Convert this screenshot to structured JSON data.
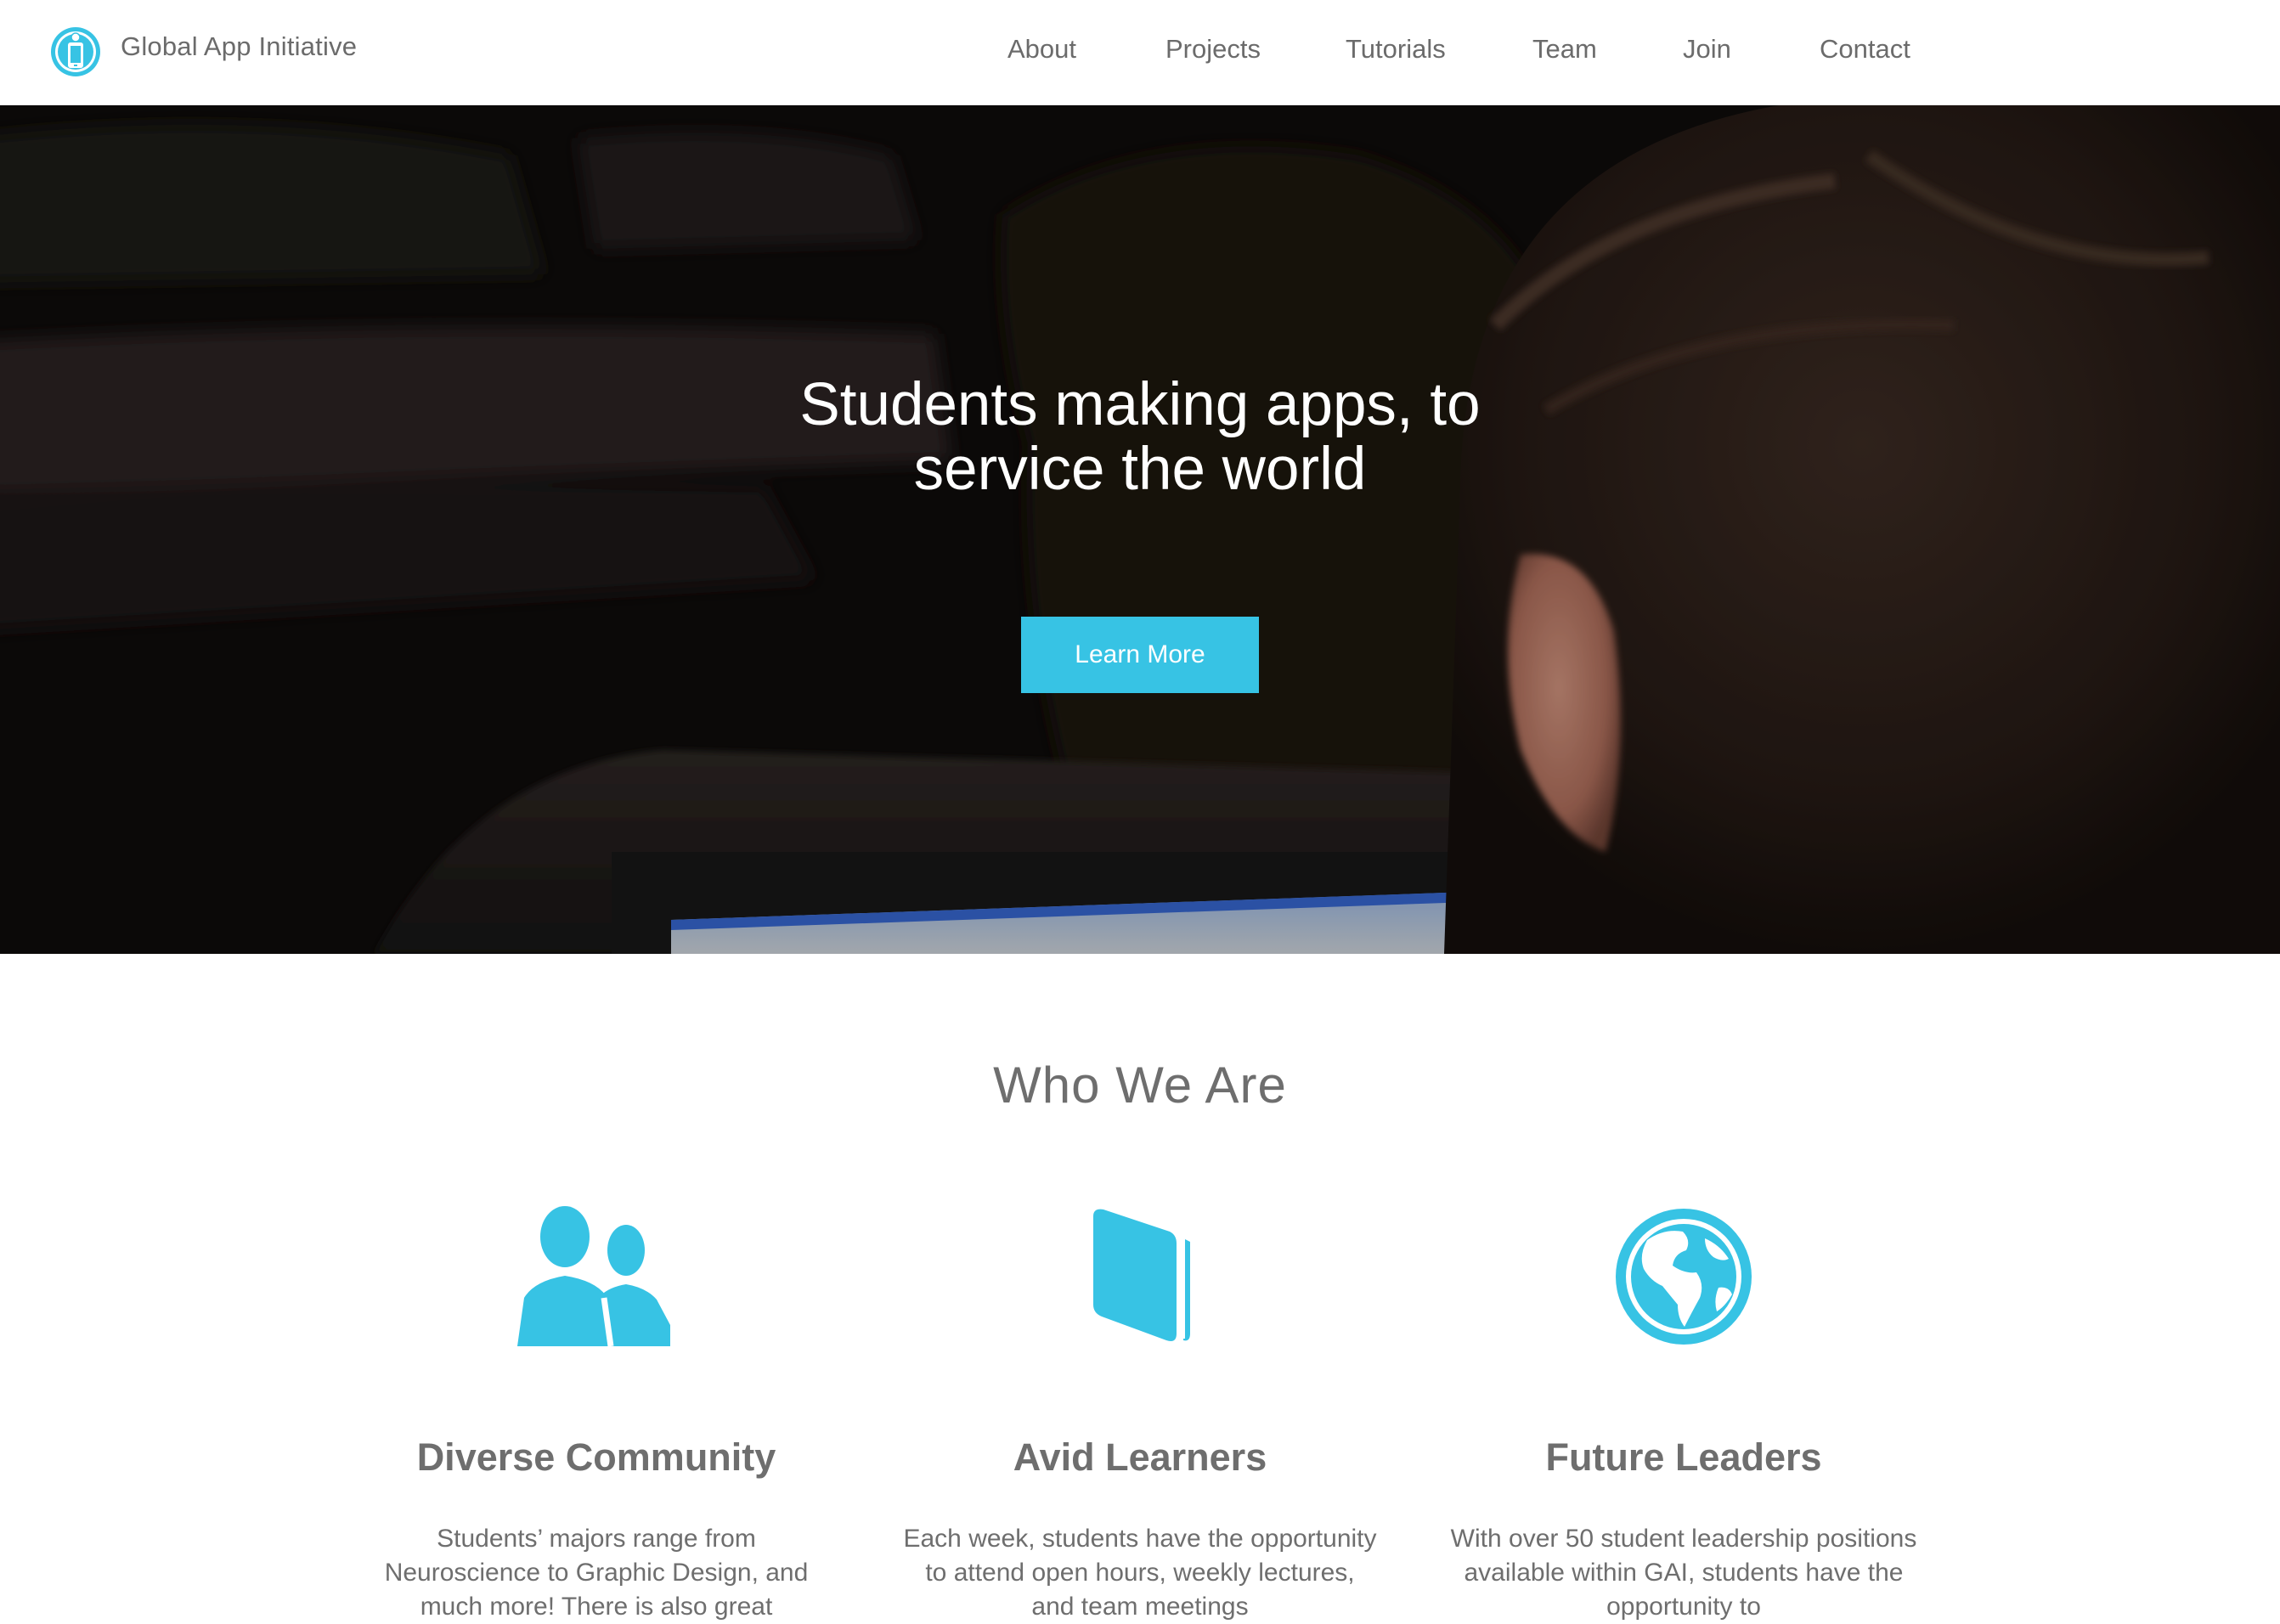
{
  "brand": {
    "name": "Global App Initiative",
    "logo_icon": "phone-globe-logo-icon"
  },
  "nav": {
    "items": [
      "About",
      "Projects",
      "Tutorials",
      "Team",
      "Join",
      "Contact"
    ]
  },
  "hero": {
    "title_line1": "Students making apps, to",
    "title_line2": "service the world",
    "cta_label": "Learn More"
  },
  "who_we_are": {
    "title": "Who We Are",
    "features": [
      {
        "icon": "people-icon",
        "title": "Diverse Community",
        "text": "Students’ majors range from Neuroscience to Graphic Design, and much more! There is also great"
      },
      {
        "icon": "book-icon",
        "title": "Avid Learners",
        "text": "Each week, students have the opportunity to attend open hours, weekly lectures, and team meetings"
      },
      {
        "icon": "globe-icon",
        "title": "Future Leaders",
        "text": "With over 50 student leadership positions available within GAI, students have the opportunity to"
      }
    ]
  },
  "colors": {
    "accent": "#37c3e4",
    "text": "#6e6e6e",
    "hero_background": "#0e0b0a",
    "nav_background": "#ffffff"
  }
}
